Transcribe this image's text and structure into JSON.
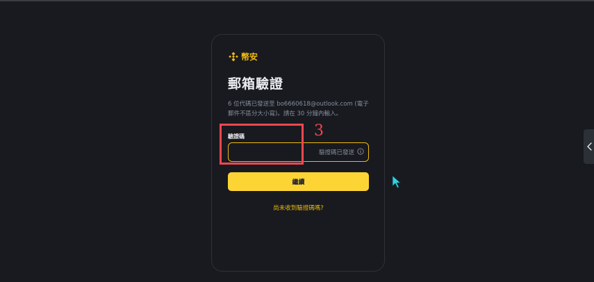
{
  "brand": {
    "name": "幣安",
    "icon": "binance-logo-icon",
    "color": "#f0b90b"
  },
  "page": {
    "title": "郵箱驗證",
    "description": "6 位代碼已發送至 bo6660618@outlook.com (電子郵件不區分大小寫)。請在 30 分鐘內輸入。"
  },
  "form": {
    "code_label": "驗證碼",
    "code_value": "",
    "code_hint": "驗證碼已發送",
    "hint_icon": "info-icon",
    "continue_label": "繼續",
    "resend_label": "尚未收到驗證碼嗎?"
  },
  "annotation": {
    "number": "3",
    "color": "#f0484e"
  },
  "theme": {
    "accent": "#fcd535",
    "background": "#181a20"
  }
}
